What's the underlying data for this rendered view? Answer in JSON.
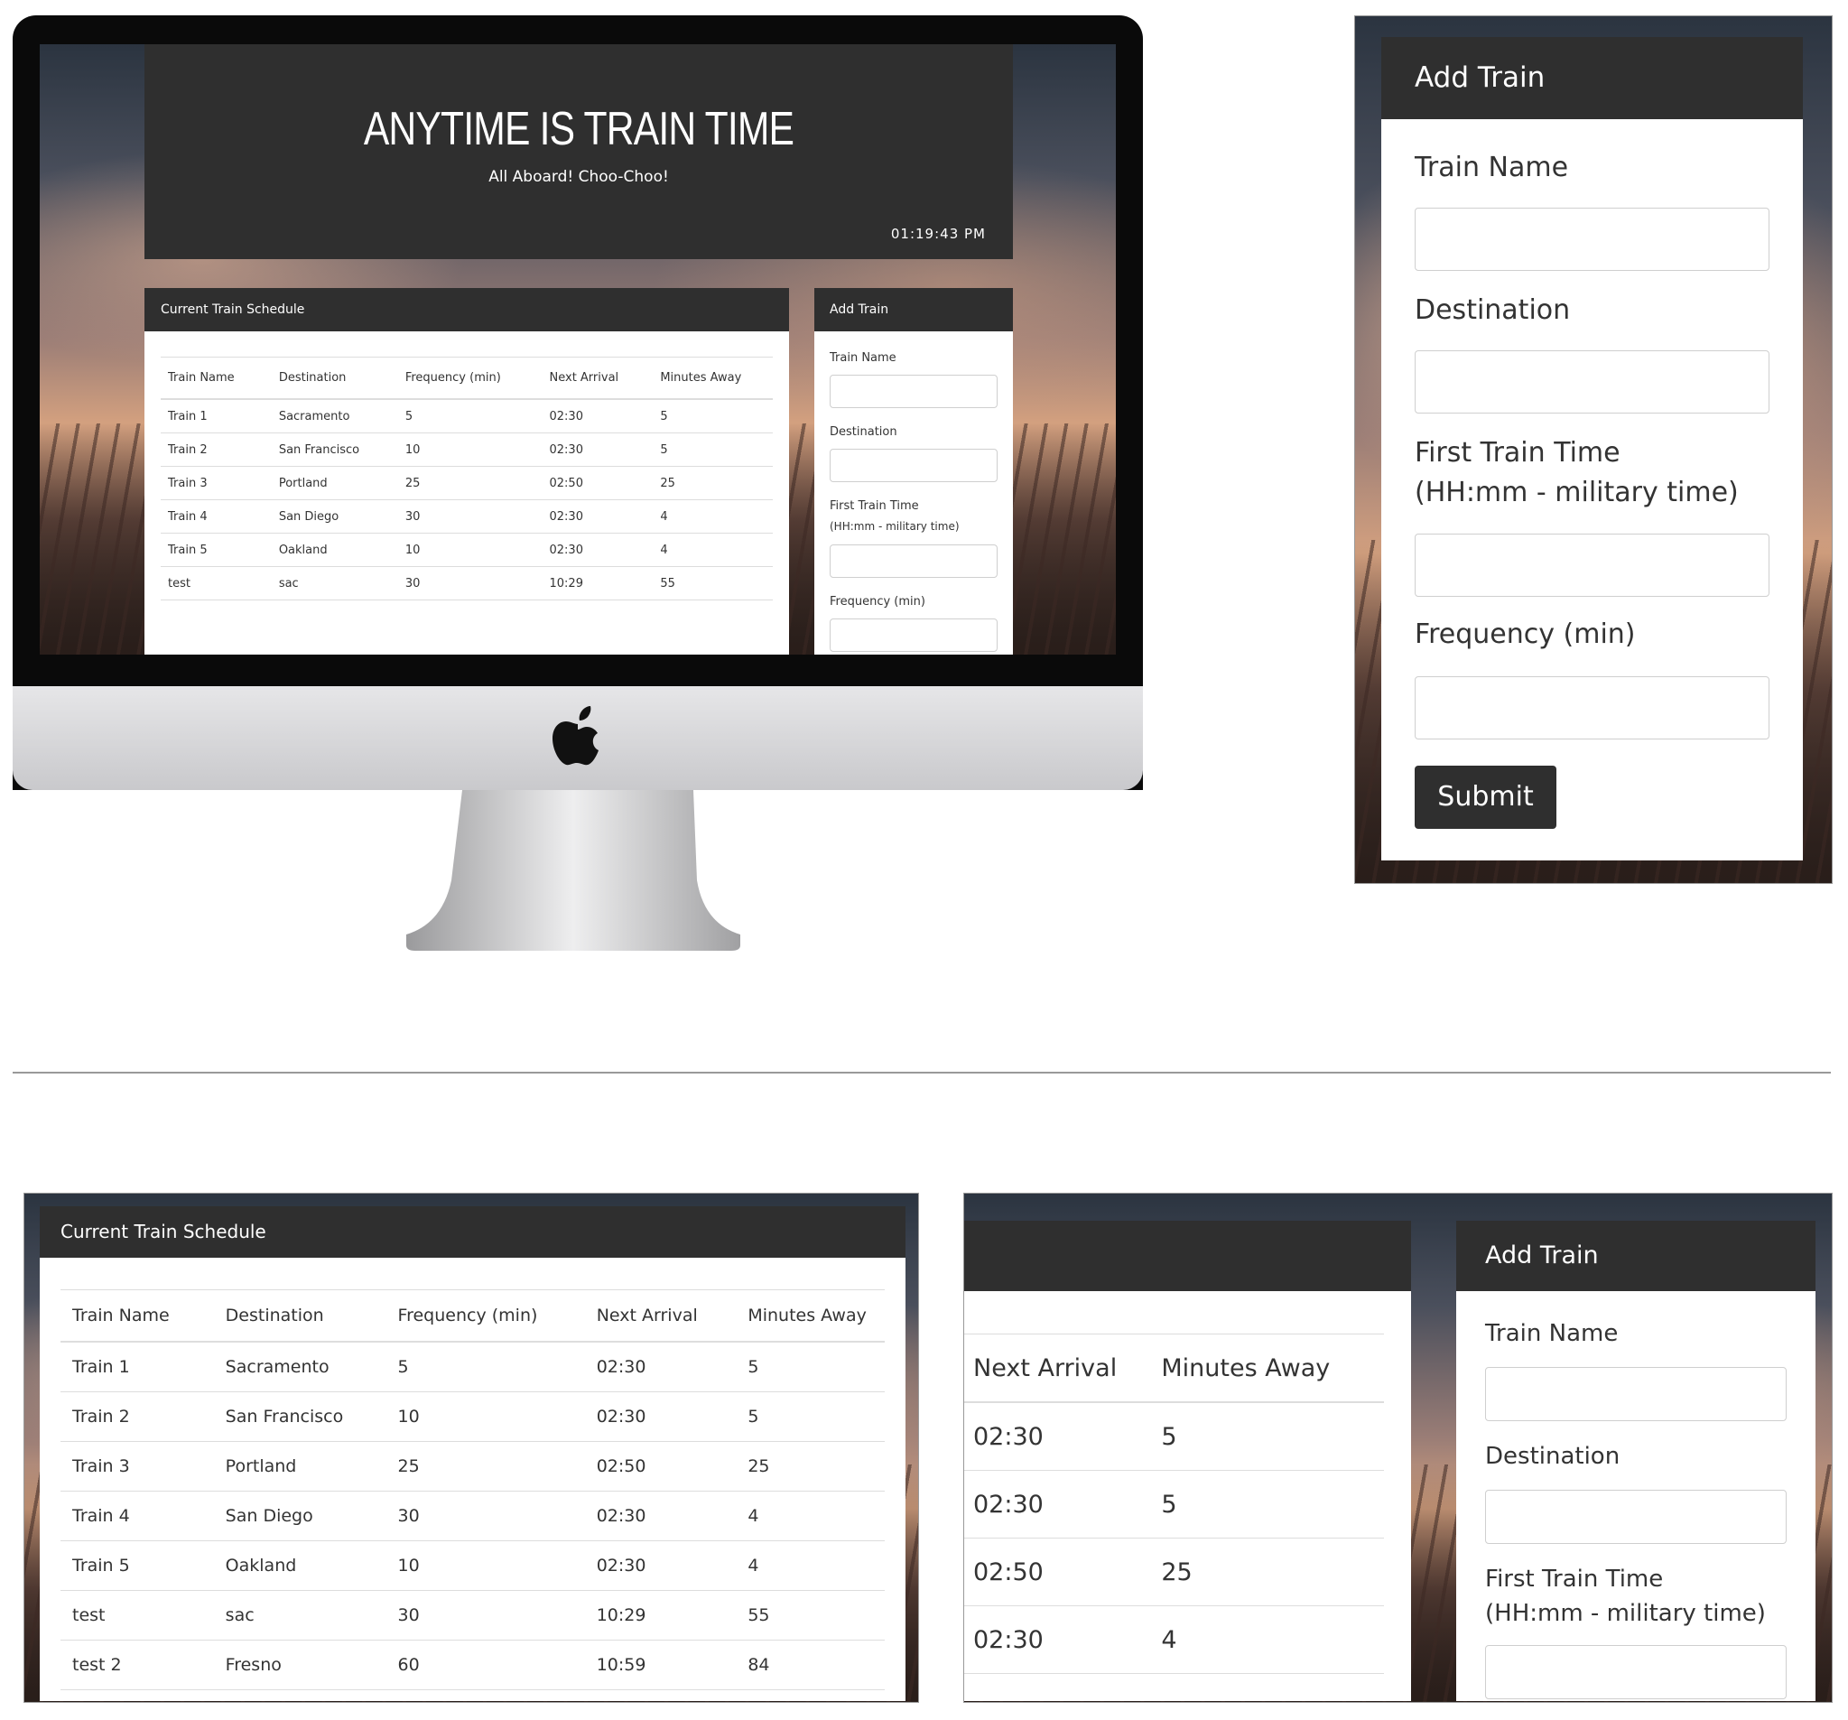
{
  "jumbotron": {
    "title": "ANYTIME IS TRAIN TIME",
    "subtitle": "All Aboard! Choo-Choo!",
    "clock": "01:19:43 PM"
  },
  "schedule": {
    "title": "Current Train Schedule",
    "columns": [
      "Train Name",
      "Destination",
      "Frequency (min)",
      "Next Arrival",
      "Minutes Away"
    ],
    "rows": [
      [
        "Train 1",
        "Sacramento",
        "5",
        "02:30",
        "5"
      ],
      [
        "Train 2",
        "San Francisco",
        "10",
        "02:30",
        "5"
      ],
      [
        "Train 3",
        "Portland",
        "25",
        "02:50",
        "25"
      ],
      [
        "Train 4",
        "San Diego",
        "30",
        "02:30",
        "4"
      ],
      [
        "Train 5",
        "Oakland",
        "10",
        "02:30",
        "4"
      ],
      [
        "test",
        "sac",
        "30",
        "10:29",
        "55"
      ],
      [
        "test 2",
        "Fresno",
        "60",
        "10:59",
        "84"
      ]
    ]
  },
  "form": {
    "title": "Add Train",
    "train_name_label": "Train Name",
    "destination_label": "Destination",
    "first_time_label_1": "First Train Time",
    "first_time_label_2": "(HH:mm - military time)",
    "frequency_label": "Frequency (min)",
    "submit_label": "Submit",
    "train_name_value": "",
    "destination_value": "",
    "first_time_value": "",
    "frequency_value": ""
  },
  "icons": {
    "monitor_logo": "apple-logo-icon"
  },
  "colors": {
    "panel_header": "#2f2f2f",
    "button": "#2f2f2f",
    "divider": "#999999"
  }
}
